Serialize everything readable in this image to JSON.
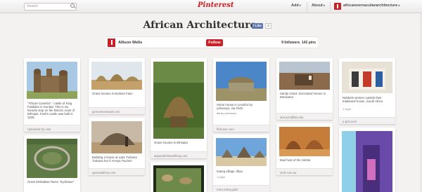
{
  "topbar": {
    "search_placeholder": "Search",
    "logo": "Pinterest",
    "add_label": "Add",
    "about_label": "About",
    "username": "africanvernaculararchitecture",
    "caret": "▾"
  },
  "board": {
    "title": "African Architecture",
    "like_label": "Like",
    "like_count": "3",
    "owner": "Allison Wells",
    "follow_label": "Follow",
    "followers": "9 followers",
    "pins": "143 pins"
  },
  "pins": [
    {
      "desc": "\"African Camelot\" - castle of King Fasilides in Gondar. This is my favorite stop on the historic route of Ethiopia. Fasil's castle was built in 1636.",
      "foot": "Uploaded by user",
      "image": "castle"
    },
    {
      "desc": "Grass houses in Burkina Faso",
      "foot": "genevievetravel.com",
      "image": "grass-huts"
    },
    {
      "desc": "Grass houses in Ethiopia",
      "foot": "aquaeskeltravelblog.com",
      "image": "ethiopia-grass-house"
    },
    {
      "desc": "Stone house in Lesotho by yoboseyo, via Flickr",
      "foot": "flickriver.com",
      "sub": "by yoboseyo",
      "image": "stone-house"
    },
    {
      "desc": "Sandy Grant: Decorated homes in Botswana",
      "foot": "arena.buffalo.edu",
      "image": "botswana-house"
    },
    {
      "desc": "Ndebele women outside their traditional house, South Africa",
      "foot": "e-gns.com",
      "sub": "1 repin",
      "image": "ndebele"
    },
    {
      "desc": "Great Zimbabwe Ruins \"Symbaoe\"",
      "foot": "",
      "image": "great-zimbabwe"
    },
    {
      "desc": "Building a house at Lake Turkana Turkana hut © Kenya Tourism",
      "foot": "apecialafrica.com",
      "image": "turkana"
    },
    {
      "desc": "",
      "foot": "",
      "image": "village"
    },
    {
      "desc": "tuareg village, libya",
      "foot": "mixx.many.gulsr",
      "sub": "1 repin",
      "image": "tuareg"
    },
    {
      "desc": "Mud huts of the Himba",
      "foot": "smh.com.au",
      "image": "himba"
    },
    {
      "desc": "",
      "foot": "",
      "image": "purple-house"
    }
  ],
  "colors": {
    "brand": "#cb2027",
    "background": "#f4f1f1"
  }
}
